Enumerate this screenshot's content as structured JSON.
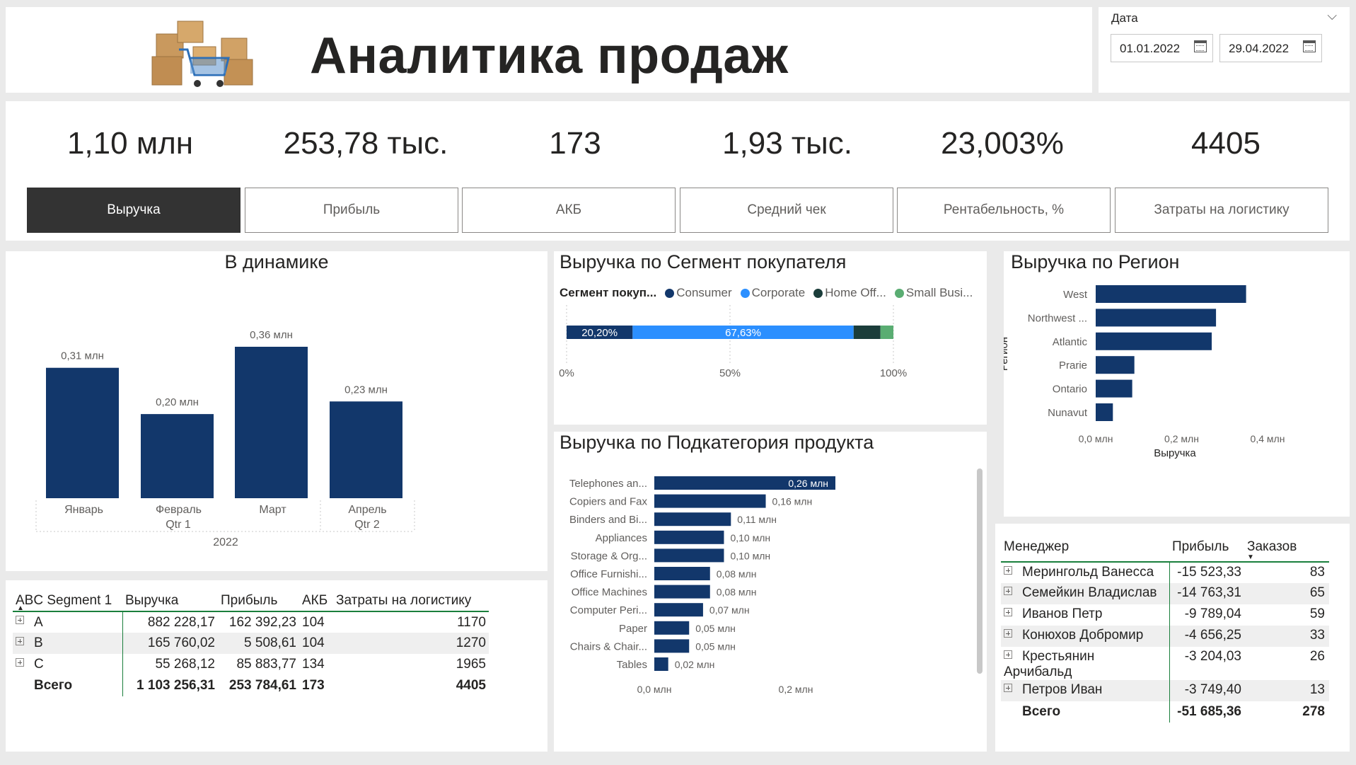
{
  "header": {
    "title": "Аналитика продаж"
  },
  "date_filter": {
    "label": "Дата",
    "from": "01.01.2022",
    "to": "29.04.2022"
  },
  "kpis": [
    {
      "value": "1,10 млн",
      "label": "Выручка",
      "active": true
    },
    {
      "value": "253,78 тыс.",
      "label": "Прибыль",
      "active": false
    },
    {
      "value": "173",
      "label": "АКБ",
      "active": false
    },
    {
      "value": "1,93 тыс.",
      "label": "Средний чек",
      "active": false
    },
    {
      "value": "23,003%",
      "label": "Рентабельность, %",
      "active": false
    },
    {
      "value": "4405",
      "label": "Затраты на логистику",
      "active": false
    }
  ],
  "colors": {
    "bar": "#12376b",
    "consumer": "#12376b",
    "corporate": "#2b8fff",
    "home_office": "#1b3d3a",
    "small_business": "#5aad72",
    "active_button": "#333333"
  },
  "chart_data": [
    {
      "type": "bar",
      "title": "В динамике",
      "categories": [
        "Январь",
        "Февраль",
        "Март",
        "Апрель"
      ],
      "values": [
        0.31,
        0.2,
        0.36,
        0.23
      ],
      "data_labels": [
        "0,31 млн",
        "0,20 млн",
        "0,36 млн",
        "0,23 млн"
      ],
      "quarters": [
        "Qtr 1",
        "Qtr 2"
      ],
      "year": "2022",
      "ylim": [
        0,
        0.36
      ]
    },
    {
      "type": "bar",
      "title": "Выручка по Сегмент покупателя",
      "legend_title": "Сегмент покуп...",
      "series": [
        {
          "name": "Consumer",
          "value": 20.2,
          "label": "20,20%"
        },
        {
          "name": "Corporate",
          "value": 67.63,
          "label": "67,63%"
        },
        {
          "name": "Home Off...",
          "value": 8.2,
          "label": ""
        },
        {
          "name": "Small Busi...",
          "value": 3.97,
          "label": ""
        }
      ],
      "x_ticks": [
        "0%",
        "50%",
        "100%"
      ],
      "xlim": [
        0,
        100
      ]
    },
    {
      "type": "bar",
      "title": "Выручка по Подкатегория продукта",
      "categories": [
        "Telephones an...",
        "Copiers and Fax",
        "Binders and Bi...",
        "Appliances",
        "Storage & Org...",
        "Office Furnishi...",
        "Office Machines",
        "Computer Peri...",
        "Paper",
        "Chairs & Chair...",
        "Tables"
      ],
      "values": [
        0.26,
        0.16,
        0.11,
        0.1,
        0.1,
        0.08,
        0.08,
        0.07,
        0.05,
        0.05,
        0.02
      ],
      "data_labels": [
        "0,26 млн",
        "0,16 млн",
        "0,11 млн",
        "0,10 млн",
        "0,10 млн",
        "0,08 млн",
        "0,08 млн",
        "0,07 млн",
        "0,05 млн",
        "0,05 млн",
        "0,02 млн"
      ],
      "x_ticks": [
        "0,0 млн",
        "0,2 млн"
      ],
      "xlim": [
        0,
        0.26
      ]
    },
    {
      "type": "bar",
      "title": "Выручка по Регион",
      "categories": [
        "West",
        "Northwest ...",
        "Atlantic",
        "Prarie",
        "Ontario",
        "Nunavut"
      ],
      "values": [
        0.35,
        0.28,
        0.27,
        0.09,
        0.085,
        0.04
      ],
      "x_ticks": [
        "0,0 млн",
        "0,2 млн",
        "0,4 млн"
      ],
      "xlim": [
        0,
        0.4
      ],
      "xlabel": "Выручка",
      "ylabel": "Регион"
    }
  ],
  "abc_table": {
    "headers": [
      "ABC Segment 1",
      "Выручка",
      "Прибыль",
      "АКБ",
      "Затраты на логистику"
    ],
    "rows": [
      [
        "A",
        "882 228,17",
        "162 392,23",
        "104",
        "1170"
      ],
      [
        "B",
        "165 760,02",
        "5 508,61",
        "104",
        "1270"
      ],
      [
        "C",
        "55 268,12",
        "85 883,77",
        "134",
        "1965"
      ]
    ],
    "total": [
      "Всего",
      "1 103 256,31",
      "253 784,61",
      "173",
      "4405"
    ]
  },
  "manager_table": {
    "headers": [
      "Менеджер",
      "Прибыль",
      "Заказов"
    ],
    "rows": [
      [
        "Мерингольд Ванесса",
        "-15 523,33",
        "83"
      ],
      [
        "Семейкин Владислав",
        "-14 763,31",
        "65"
      ],
      [
        "Иванов Петр",
        "-9 789,04",
        "59"
      ],
      [
        "Конюхов Добромир",
        "-4 656,25",
        "33"
      ],
      [
        "Крестьянин Арчибальд",
        "-3 204,03",
        "26"
      ],
      [
        "Петров Иван",
        "-3 749,40",
        "13"
      ]
    ],
    "total": [
      "Всего",
      "-51 685,36",
      "278"
    ]
  }
}
